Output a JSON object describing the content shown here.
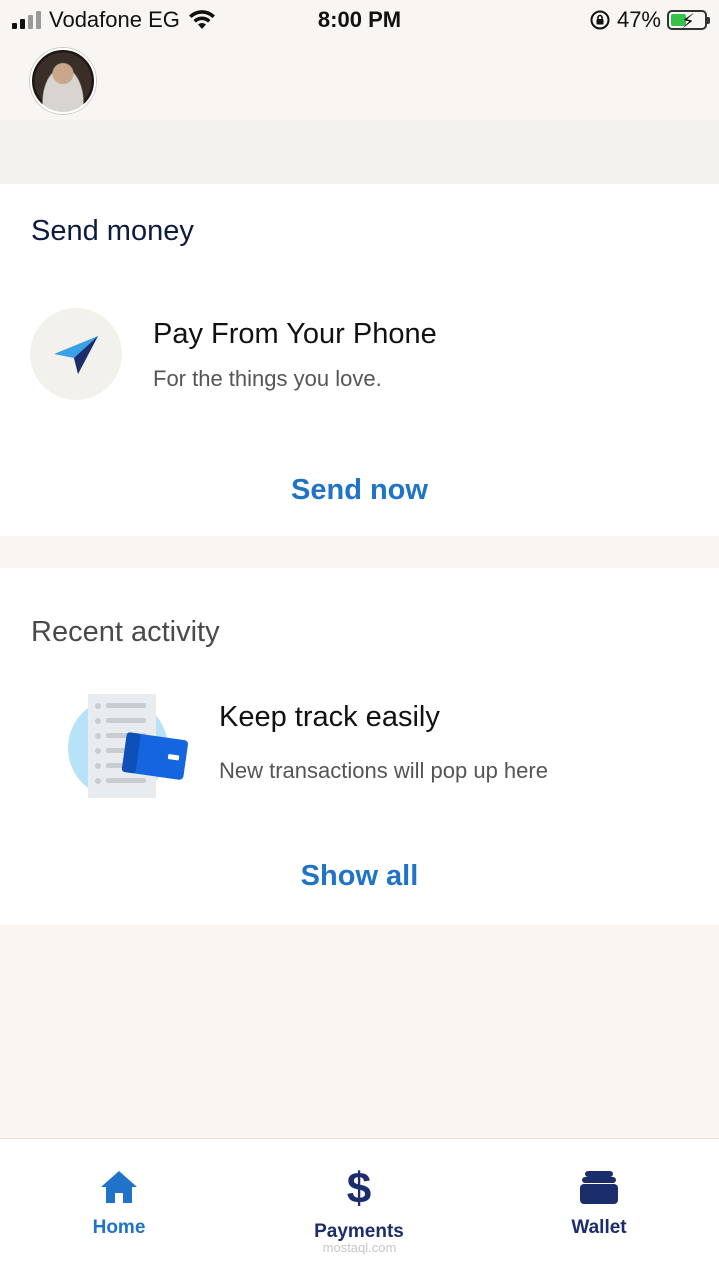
{
  "status_bar": {
    "carrier": "Vodafone EG",
    "time": "8:00 PM",
    "battery_percent": "47%",
    "battery_level": 0.47,
    "icons": [
      "signal-icon",
      "wifi-icon",
      "orientation-lock-icon",
      "battery-charging-icon"
    ]
  },
  "header": {
    "avatar_icon": "user-avatar"
  },
  "send_money": {
    "title": "Send money",
    "feature_title": "Pay From Your Phone",
    "feature_subtitle": "For the things you love.",
    "action": "Send now",
    "icon": "paper-plane-icon"
  },
  "recent_activity": {
    "title": "Recent activity",
    "feature_title": "Keep track easily",
    "feature_subtitle": "New transactions will pop up here",
    "action": "Show all",
    "icon": "receipt-card-illustration"
  },
  "bottom_nav": {
    "items": [
      {
        "label": "Home",
        "icon": "home-icon",
        "active": true
      },
      {
        "label": "Payments",
        "icon": "dollar-icon",
        "active": false
      },
      {
        "label": "Wallet",
        "icon": "wallet-icon",
        "active": false
      }
    ]
  },
  "watermark": {
    "text": "mostaql.com"
  },
  "colors": {
    "accent": "#1f73c8",
    "nav_dark": "#1c2d6b",
    "background": "#f8f5f2",
    "card": "#ffffff"
  }
}
